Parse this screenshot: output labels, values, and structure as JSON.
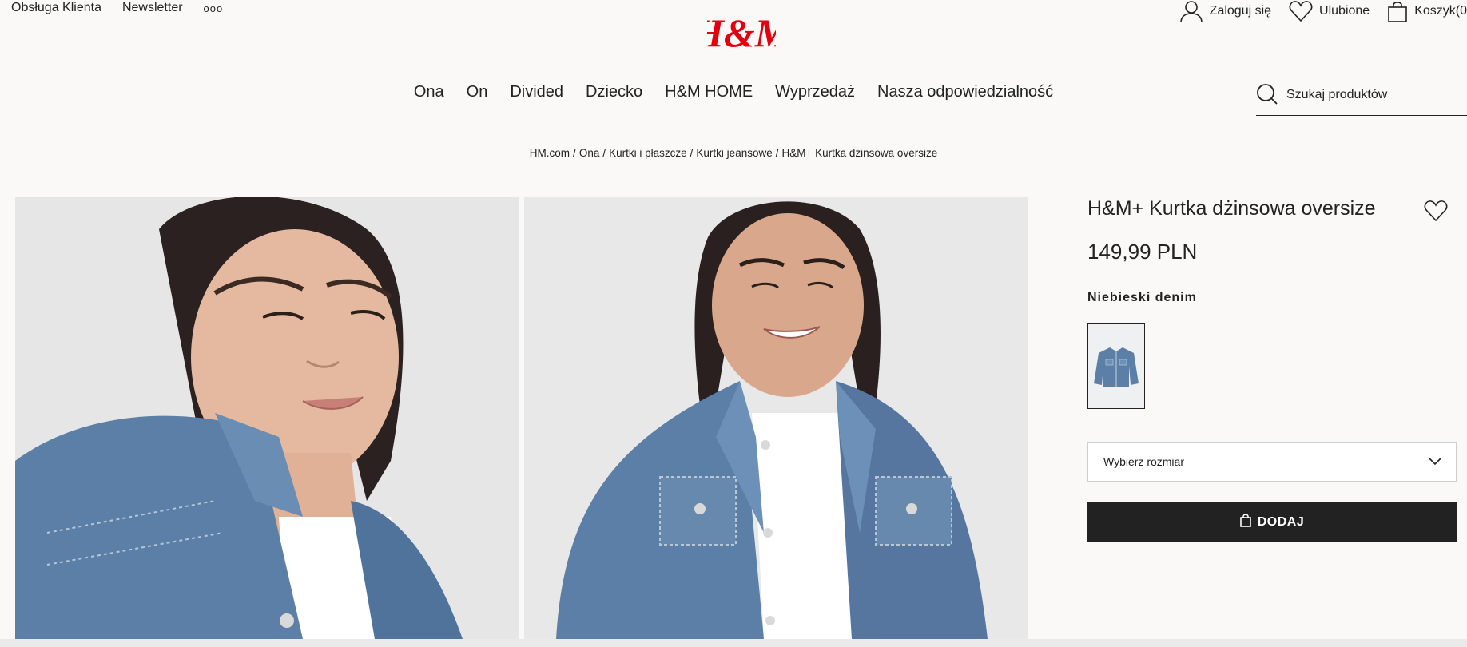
{
  "utility_left": {
    "customer_service": "Obsługa Klienta",
    "newsletter": "Newsletter",
    "more": "ooo"
  },
  "logo": {
    "text": "H&M",
    "color": "#e50010"
  },
  "utility_right": {
    "login": "Zaloguj się",
    "favorites": "Ulubione",
    "cart": "Koszyk(0"
  },
  "nav": {
    "items": [
      "Ona",
      "On",
      "Divided",
      "Dziecko",
      "H&M HOME",
      "Wyprzedaż",
      "Nasza odpowiedzialność"
    ]
  },
  "search": {
    "placeholder": "Szukaj produktów"
  },
  "breadcrumb": [
    "HM.com",
    "Ona",
    "Kurtki i płaszcze",
    "Kurtki jeansowe",
    "H&M+ Kurtka dżinsowa oversize"
  ],
  "product": {
    "name": "H&M+ Kurtka dżinsowa oversize",
    "price": "149,99 PLN",
    "color_name": "Niebieski denim",
    "size_select": "Wybierz rozmiar",
    "add_button": "DODAJ"
  },
  "colors": {
    "accent": "#e50010",
    "button_bg": "#222222",
    "page_bg": "#faf9f8",
    "denim": "#5b7fa6"
  },
  "icons": [
    "more-dots-icon",
    "user-icon",
    "heart-icon",
    "bag-icon",
    "search-icon",
    "chevron-down-icon",
    "bag-small-icon"
  ]
}
